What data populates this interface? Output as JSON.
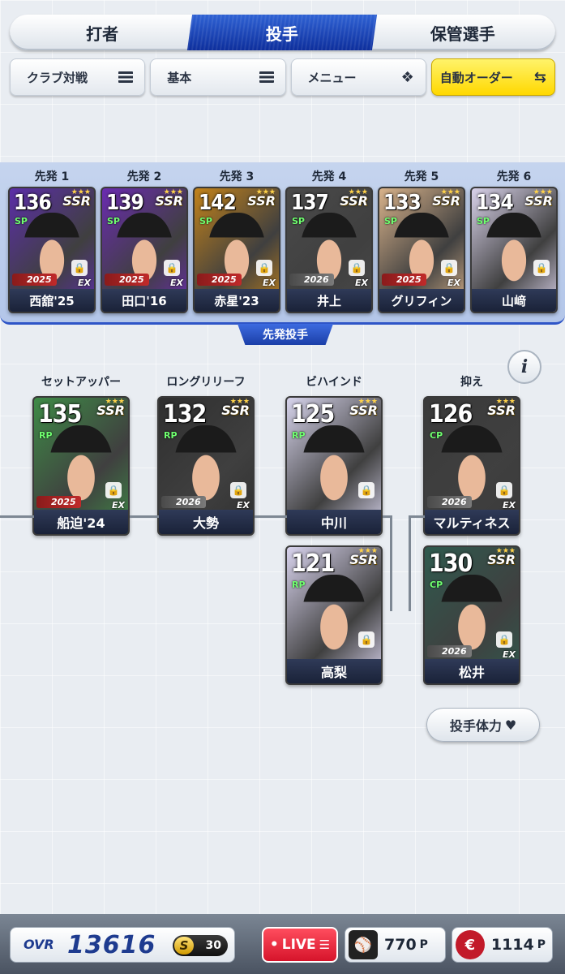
{
  "tabs": [
    {
      "label": "打者",
      "active": false
    },
    {
      "label": "投手",
      "active": true
    },
    {
      "label": "保管選手",
      "active": false
    }
  ],
  "toolbar": {
    "club_battle": "クラブ対戦",
    "basic": "基本",
    "menu": "メニュー",
    "auto_order": "自動オーダー"
  },
  "section_label": "先発投手",
  "starters": [
    {
      "slot": "先発 1",
      "ovr": "136",
      "pos": "SP",
      "rarity": "SSR",
      "year": "2025",
      "name": "西舘'25",
      "bg": "#5b2ea8"
    },
    {
      "slot": "先発 2",
      "ovr": "139",
      "pos": "SP",
      "rarity": "SSR",
      "year": "2025",
      "name": "田口'16",
      "bg": "#6a2bb0"
    },
    {
      "slot": "先発 3",
      "ovr": "142",
      "pos": "SP",
      "rarity": "SSR",
      "year": "2025",
      "name": "赤星'23",
      "bg": "#c2821a"
    },
    {
      "slot": "先発 4",
      "ovr": "137",
      "pos": "SP",
      "rarity": "SSR",
      "year": "2026",
      "name": "井上",
      "bg": "#4a4a4a"
    },
    {
      "slot": "先発 5",
      "ovr": "133",
      "pos": "SP",
      "rarity": "SSR",
      "year": "2025",
      "name": "グリフィン",
      "bg": "#d8b28a"
    },
    {
      "slot": "先発 6",
      "ovr": "134",
      "pos": "SP",
      "rarity": "SSR",
      "year": "",
      "name": "山﨑",
      "bg": "#d9d2ea"
    }
  ],
  "relievers": {
    "setup": {
      "slot": "セットアッパー",
      "ovr": "135",
      "pos": "RP",
      "rarity": "SSR",
      "year": "2025",
      "name": "船迫'24",
      "bg": "#3e8a46"
    },
    "long": {
      "slot": "ロングリリーフ",
      "ovr": "132",
      "pos": "RP",
      "rarity": "SSR",
      "year": "2026",
      "name": "大勢",
      "bg": "#2f2f2f"
    },
    "behind1": {
      "slot": "ビハインド",
      "ovr": "125",
      "pos": "RP",
      "rarity": "SSR",
      "year": "",
      "name": "中川",
      "bg": "#d7d4ec"
    },
    "behind2": {
      "ovr": "121",
      "pos": "RP",
      "rarity": "SSR",
      "year": "",
      "name": "高梨",
      "bg": "#d9d4ee"
    },
    "closer1": {
      "slot": "抑え",
      "ovr": "126",
      "pos": "CP",
      "rarity": "SSR",
      "year": "2026",
      "name": "マルティネス",
      "bg": "#3a3a3a"
    },
    "closer2": {
      "ovr": "130",
      "pos": "CP",
      "rarity": "SSR",
      "year": "2026",
      "name": "松井",
      "bg": "#2f5a4e"
    }
  },
  "ex_label": "EX",
  "stamina_button": "投手体力",
  "footer": {
    "ovr_label": "OVR",
    "ovr_value": "13616",
    "s_rank": "S",
    "s_count": "30",
    "live": "LIVE",
    "points1": "770",
    "points1_unit": "P",
    "points2": "1114",
    "points2_unit": "P"
  }
}
